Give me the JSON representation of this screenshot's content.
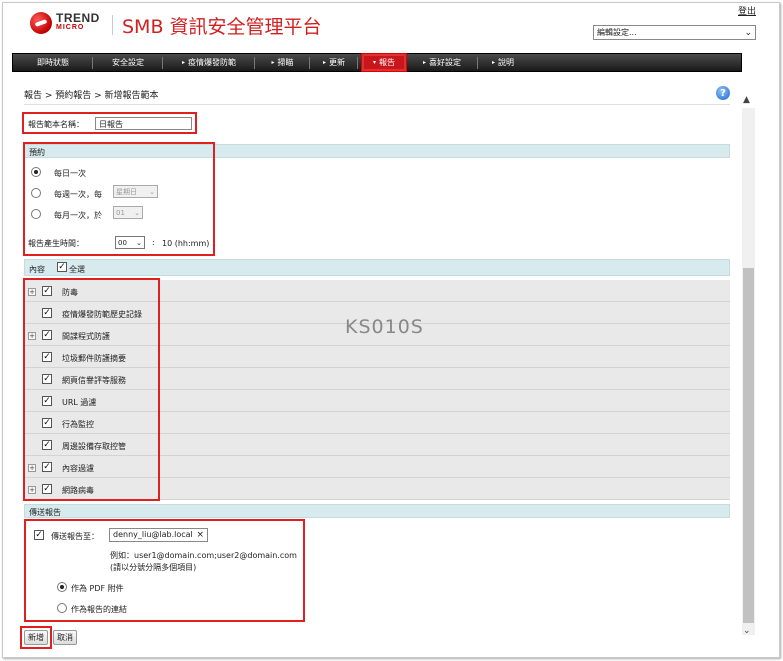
{
  "header": {
    "brand_line1": "TREND",
    "brand_line2": "MICRO",
    "app_title": "SMB 資訊安全管理平台",
    "logout": "登出",
    "edit_settings": "編輯設定..."
  },
  "nav": {
    "items": [
      "即時狀態",
      "安全設定",
      "疫情爆發防範",
      "掃瞄",
      "更新",
      "報告",
      "喜好設定",
      "說明"
    ]
  },
  "breadcrumb": "報告 > 預約報告 > 新增報告範本",
  "template_name": {
    "label": "報告範本名稱：",
    "value": "日報告"
  },
  "schedule": {
    "header": "預約",
    "daily": "每日一次",
    "weekly": "每週一次，每",
    "weekday": "星期日",
    "monthly": "每月一次，於",
    "monthday": "01",
    "time_label": "報告產生時間：",
    "hour": "00",
    "colon": ":",
    "minute_suffix": "10 (hh:mm)"
  },
  "content": {
    "header": "內容",
    "select_all": "全選",
    "items": [
      "防毒",
      "疫情爆發防範歷史記錄",
      "間諜程式防護",
      "垃圾郵件防護摘要",
      "網頁信譽評等服務",
      "URL 過濾",
      "行為監控",
      "周邊設備存取控管",
      "內容過濾",
      "網路病毒"
    ]
  },
  "send": {
    "header": "傳送報告",
    "send_to": "傳送報告至：",
    "email": "denny_liu@lab.local",
    "example": "例如：user1@domain.com;user2@domain.com",
    "hint": "(請以分號分隔多個項目)",
    "as_pdf": "作為 PDF 附件",
    "as_link": "作為報告的連結"
  },
  "buttons": {
    "add": "新增",
    "cancel": "取消"
  },
  "watermark": "KS010S"
}
